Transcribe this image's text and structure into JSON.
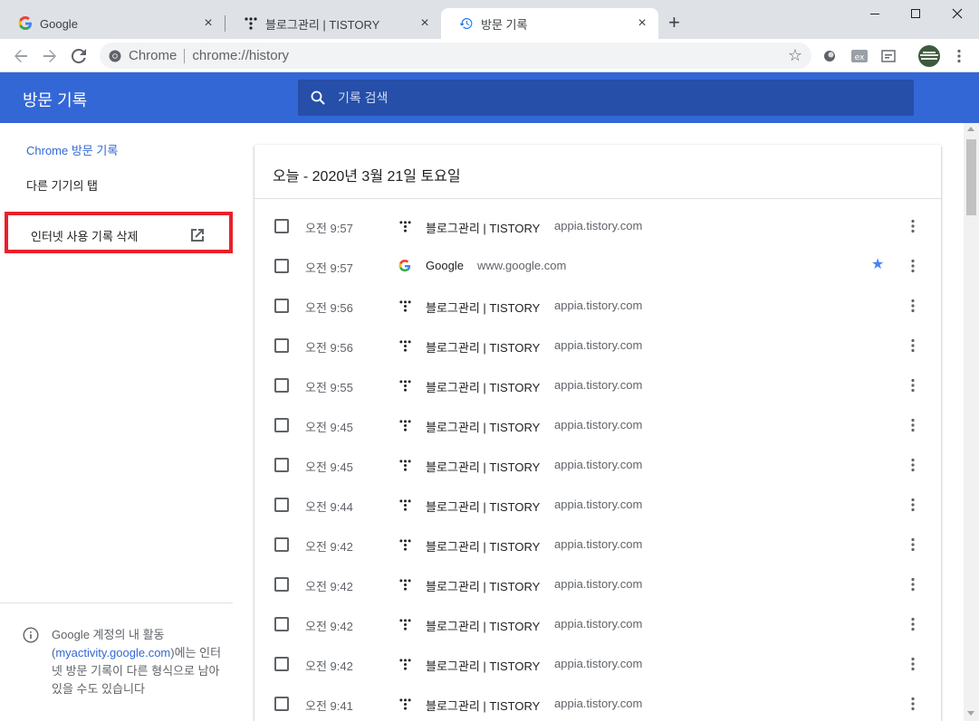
{
  "tabs": [
    {
      "title": "Google",
      "icon": "google-icon",
      "active": false
    },
    {
      "title": "블로그관리 | TISTORY",
      "icon": "tistory-icon",
      "active": false
    },
    {
      "title": "방문 기록",
      "icon": "history-icon",
      "active": true
    }
  ],
  "tab_close_glyph": "×",
  "new_tab_glyph": "+",
  "omnibox": {
    "site_label": "Chrome",
    "url": "chrome://history"
  },
  "header": {
    "title": "방문 기록",
    "search_placeholder": "기록 검색"
  },
  "sidebar": {
    "items": [
      {
        "label": "Chrome 방문 기록",
        "selected": true
      },
      {
        "label": "다른 기기의 탭",
        "selected": false
      }
    ],
    "clear_label": "인터넷 사용 기록 삭제",
    "footer": {
      "text_before": "Google 계정의 내 활동 (",
      "link": "myactivity.google.com",
      "text_after": ")에는 인터넷 방문 기록이 다른 형식으로 남아 있을 수도 있습니다"
    }
  },
  "card": {
    "date": "오늘 - 2020년 3월 21일 토요일",
    "rows": [
      {
        "time": "오전 9:57",
        "title": "블로그관리 | TISTORY",
        "domain": "appia.tistory.com",
        "icon": "tistory-icon",
        "starred": false
      },
      {
        "time": "오전 9:57",
        "title": "Google",
        "domain": "www.google.com",
        "icon": "google-icon",
        "starred": true
      },
      {
        "time": "오전 9:56",
        "title": "블로그관리 | TISTORY",
        "domain": "appia.tistory.com",
        "icon": "tistory-icon",
        "starred": false
      },
      {
        "time": "오전 9:56",
        "title": "블로그관리 | TISTORY",
        "domain": "appia.tistory.com",
        "icon": "tistory-icon",
        "starred": false
      },
      {
        "time": "오전 9:55",
        "title": "블로그관리 | TISTORY",
        "domain": "appia.tistory.com",
        "icon": "tistory-icon",
        "starred": false
      },
      {
        "time": "오전 9:45",
        "title": "블로그관리 | TISTORY",
        "domain": "appia.tistory.com",
        "icon": "tistory-icon",
        "starred": false
      },
      {
        "time": "오전 9:45",
        "title": "블로그관리 | TISTORY",
        "domain": "appia.tistory.com",
        "icon": "tistory-icon",
        "starred": false
      },
      {
        "time": "오전 9:44",
        "title": "블로그관리 | TISTORY",
        "domain": "appia.tistory.com",
        "icon": "tistory-icon",
        "starred": false
      },
      {
        "time": "오전 9:42",
        "title": "블로그관리 | TISTORY",
        "domain": "appia.tistory.com",
        "icon": "tistory-icon",
        "starred": false
      },
      {
        "time": "오전 9:42",
        "title": "블로그관리 | TISTORY",
        "domain": "appia.tistory.com",
        "icon": "tistory-icon",
        "starred": false
      },
      {
        "time": "오전 9:42",
        "title": "블로그관리 | TISTORY",
        "domain": "appia.tistory.com",
        "icon": "tistory-icon",
        "starred": false
      },
      {
        "time": "오전 9:42",
        "title": "블로그관리 | TISTORY",
        "domain": "appia.tistory.com",
        "icon": "tistory-icon",
        "starred": false
      },
      {
        "time": "오전 9:41",
        "title": "블로그관리 | TISTORY",
        "domain": "appia.tistory.com",
        "icon": "tistory-icon",
        "starred": false
      }
    ]
  },
  "colors": {
    "accent": "#3367d6",
    "search_bg": "#254fa8",
    "highlight_box": "#e8202a",
    "star": "#4285f4"
  }
}
